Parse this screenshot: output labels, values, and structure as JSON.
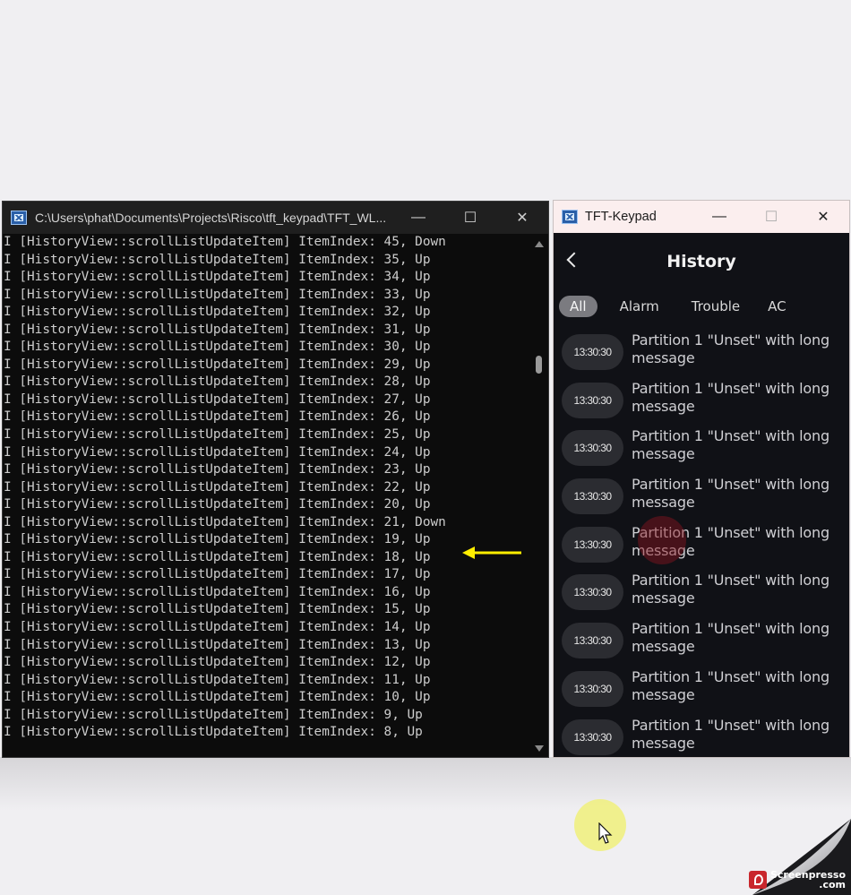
{
  "console": {
    "title": "C:\\Users\\phat\\Documents\\Projects\\Risco\\tft_keypad\\TFT_WL...",
    "icon": "terminal-app-icon",
    "controls": {
      "minimize": "—",
      "maximize": "☐",
      "close": "✕"
    },
    "log_lines": [
      "I [HistoryView::scrollListUpdateItem] ItemIndex: 45, Down",
      "I [HistoryView::scrollListUpdateItem] ItemIndex: 35, Up",
      "I [HistoryView::scrollListUpdateItem] ItemIndex: 34, Up",
      "I [HistoryView::scrollListUpdateItem] ItemIndex: 33, Up",
      "I [HistoryView::scrollListUpdateItem] ItemIndex: 32, Up",
      "I [HistoryView::scrollListUpdateItem] ItemIndex: 31, Up",
      "I [HistoryView::scrollListUpdateItem] ItemIndex: 30, Up",
      "I [HistoryView::scrollListUpdateItem] ItemIndex: 29, Up",
      "I [HistoryView::scrollListUpdateItem] ItemIndex: 28, Up",
      "I [HistoryView::scrollListUpdateItem] ItemIndex: 27, Up",
      "I [HistoryView::scrollListUpdateItem] ItemIndex: 26, Up",
      "I [HistoryView::scrollListUpdateItem] ItemIndex: 25, Up",
      "I [HistoryView::scrollListUpdateItem] ItemIndex: 24, Up",
      "I [HistoryView::scrollListUpdateItem] ItemIndex: 23, Up",
      "I [HistoryView::scrollListUpdateItem] ItemIndex: 22, Up",
      "I [HistoryView::scrollListUpdateItem] ItemIndex: 20, Up",
      "I [HistoryView::scrollListUpdateItem] ItemIndex: 21, Down",
      "I [HistoryView::scrollListUpdateItem] ItemIndex: 19, Up",
      "I [HistoryView::scrollListUpdateItem] ItemIndex: 18, Up",
      "I [HistoryView::scrollListUpdateItem] ItemIndex: 17, Up",
      "I [HistoryView::scrollListUpdateItem] ItemIndex: 16, Up",
      "I [HistoryView::scrollListUpdateItem] ItemIndex: 15, Up",
      "I [HistoryView::scrollListUpdateItem] ItemIndex: 14, Up",
      "I [HistoryView::scrollListUpdateItem] ItemIndex: 13, Up",
      "I [HistoryView::scrollListUpdateItem] ItemIndex: 12, Up",
      "I [HistoryView::scrollListUpdateItem] ItemIndex: 11, Up",
      "I [HistoryView::scrollListUpdateItem] ItemIndex: 10, Up",
      "I [HistoryView::scrollListUpdateItem] ItemIndex: 9, Up",
      "I [HistoryView::scrollListUpdateItem] ItemIndex: 8, Up"
    ],
    "annotation": {
      "icon": "yellow-arrow-icon",
      "color": "#ffee00"
    }
  },
  "keypad": {
    "title": "TFT-Keypad",
    "controls": {
      "minimize": "—",
      "maximize": "☐",
      "close": "✕"
    },
    "header_title": "History",
    "tabs": [
      "All",
      "Alarm",
      "Trouble",
      "AC"
    ],
    "active_tab": "All",
    "history": [
      {
        "time": "13:30:30",
        "message": "Partition 1 \"Unset\" with long message"
      },
      {
        "time": "13:30:30",
        "message": "Partition 1 \"Unset\" with long message"
      },
      {
        "time": "13:30:30",
        "message": "Partition 1 \"Unset\" with long message"
      },
      {
        "time": "13:30:30",
        "message": "Partition 1 \"Unset\" with long message"
      },
      {
        "time": "13:30:30",
        "message": "Partition 1 \"Unset\" with long message"
      },
      {
        "time": "13:30:30",
        "message": "Partition 1 \"Unset\" with long message"
      },
      {
        "time": "13:30:30",
        "message": "Partition 1 \"Unset\" with long message"
      },
      {
        "time": "13:30:30",
        "message": "Partition 1 \"Unset\" with long message"
      },
      {
        "time": "13:30:30",
        "message": "Partition 1 \"Unset\" with long message"
      }
    ],
    "colors": {
      "background": "#101116",
      "pill": "#2b2c31",
      "active_tab": "#7b7b80",
      "titlebar": "#fbeeee"
    }
  },
  "watermark": {
    "line1": "Screenpresso",
    "line2": ".com"
  }
}
